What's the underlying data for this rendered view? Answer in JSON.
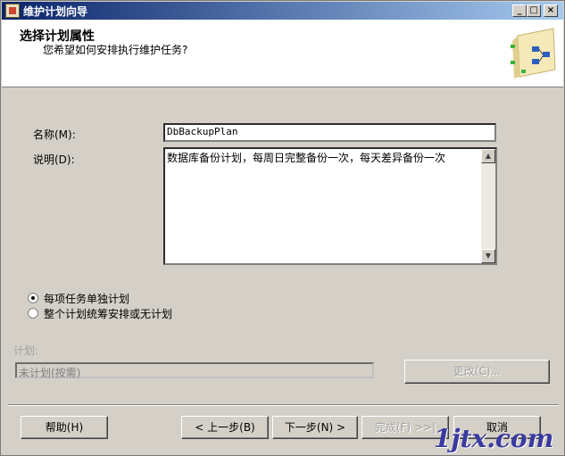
{
  "window": {
    "title": "维护计划向导"
  },
  "titlebar_buttons": {
    "min": "_",
    "max": "□",
    "close": "×"
  },
  "header": {
    "title": "选择计划属性",
    "subtitle": "您希望如何安排执行维护任务?"
  },
  "form": {
    "name_label": "名称(M):",
    "name_value": "DbBackupPlan",
    "desc_label": "说明(D):",
    "desc_value": "数据库备份计划，每周日完整备份一次，每天差异备份一次"
  },
  "options": {
    "selected": "separate",
    "separate_label": "每项任务单独计划",
    "single_label": "整个计划统筹安排或无计划"
  },
  "schedule": {
    "label": "计划:",
    "value": "未计划(按需)",
    "change_button": "更改(C)..."
  },
  "buttons": {
    "help": "帮助(H)",
    "back": "< 上一步(B)",
    "next": "下一步(N) >",
    "finish": "完成(F) >>|",
    "cancel": "取消"
  },
  "watermark": "1jtx.com"
}
